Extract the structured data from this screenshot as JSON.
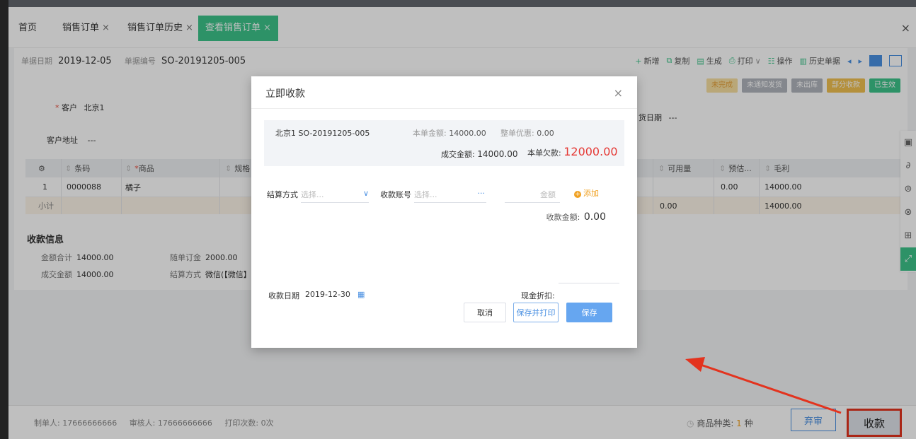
{
  "tabs": [
    {
      "label": "首页",
      "close": ""
    },
    {
      "label": "销售订单",
      "close": "×"
    },
    {
      "label": "销售订单历史",
      "close": "×"
    },
    {
      "label": "查看销售订单",
      "close": "×"
    }
  ],
  "tabs_close": "×",
  "doc": {
    "date_key": "单据日期",
    "date": "2019-12-05",
    "no_key": "单据编号",
    "no": "SO-20191205-005"
  },
  "toolbar": {
    "new": "新增",
    "copy": "复制",
    "generate": "生成",
    "print": "打印",
    "operate": "操作",
    "history": "历史单据"
  },
  "statuses": [
    "未完成",
    "未通知发货",
    "未出库",
    "部分收款",
    "已生效"
  ],
  "form": {
    "customer_label": "客户",
    "customer": "北京1",
    "address_label": "客户地址",
    "address": "---",
    "ship_date_label": "货日期",
    "ship_date": "---"
  },
  "grid": {
    "headers": {
      "barcode": "条码",
      "product": "商品",
      "spec": "规格",
      "available": "可用量",
      "estimate": "预估...",
      "profit": "毛利"
    },
    "rows": [
      {
        "no": "1",
        "barcode": "0000088",
        "product": "橘子",
        "estimate": "0.00",
        "profit": "14000.00"
      }
    ],
    "subtotal": {
      "label": "小计",
      "available": "0.00",
      "profit": "14000.00"
    }
  },
  "payment": {
    "title": "收款信息",
    "amount_total_label": "金额合计",
    "amount_total": "14000.00",
    "deposit_label": "随单订金",
    "deposit": "2000.00",
    "deal_amount_label": "成交金额",
    "deal_amount": "14000.00",
    "method_label": "结算方式",
    "method": "微信(【微信】"
  },
  "footer": {
    "creator": "制单人: 17666666666",
    "auditor": "审核人: 17666666666",
    "prints": "打印次数: 0次",
    "kinds_label": "商品种类: ",
    "kinds_num": "1",
    "kinds_unit": " 种",
    "abandon": "弃审",
    "collect": "收款"
  },
  "modal": {
    "title": "立即收款",
    "close": "×",
    "order": "北京1 SO-20191205-005",
    "amount_label": "本单金额: ",
    "amount": "14000.00",
    "discount_label": "整单优惠: ",
    "discount": "0.00",
    "deal_label": "成交金额: ",
    "deal": "14000.00",
    "owe_label": "本单欠款: ",
    "owe": "12000.00",
    "method_label": "结算方式",
    "method_placeholder": "选择...",
    "account_label": "收款账号",
    "account_placeholder": "选择...",
    "account_more": "···",
    "money_placeholder": "金额",
    "add": "添加",
    "collected_label": "收款金额: ",
    "collected": "0.00",
    "date_label": "收款日期",
    "date": "2019-12-30",
    "cash_discount_label": "现金折扣:",
    "cancel": "取消",
    "save_print": "保存并打印",
    "save": "保存"
  },
  "colors": {
    "accent": "#3cc38a",
    "primary": "#4a90e2",
    "danger": "#e53935",
    "highlight": "#e3331e"
  }
}
